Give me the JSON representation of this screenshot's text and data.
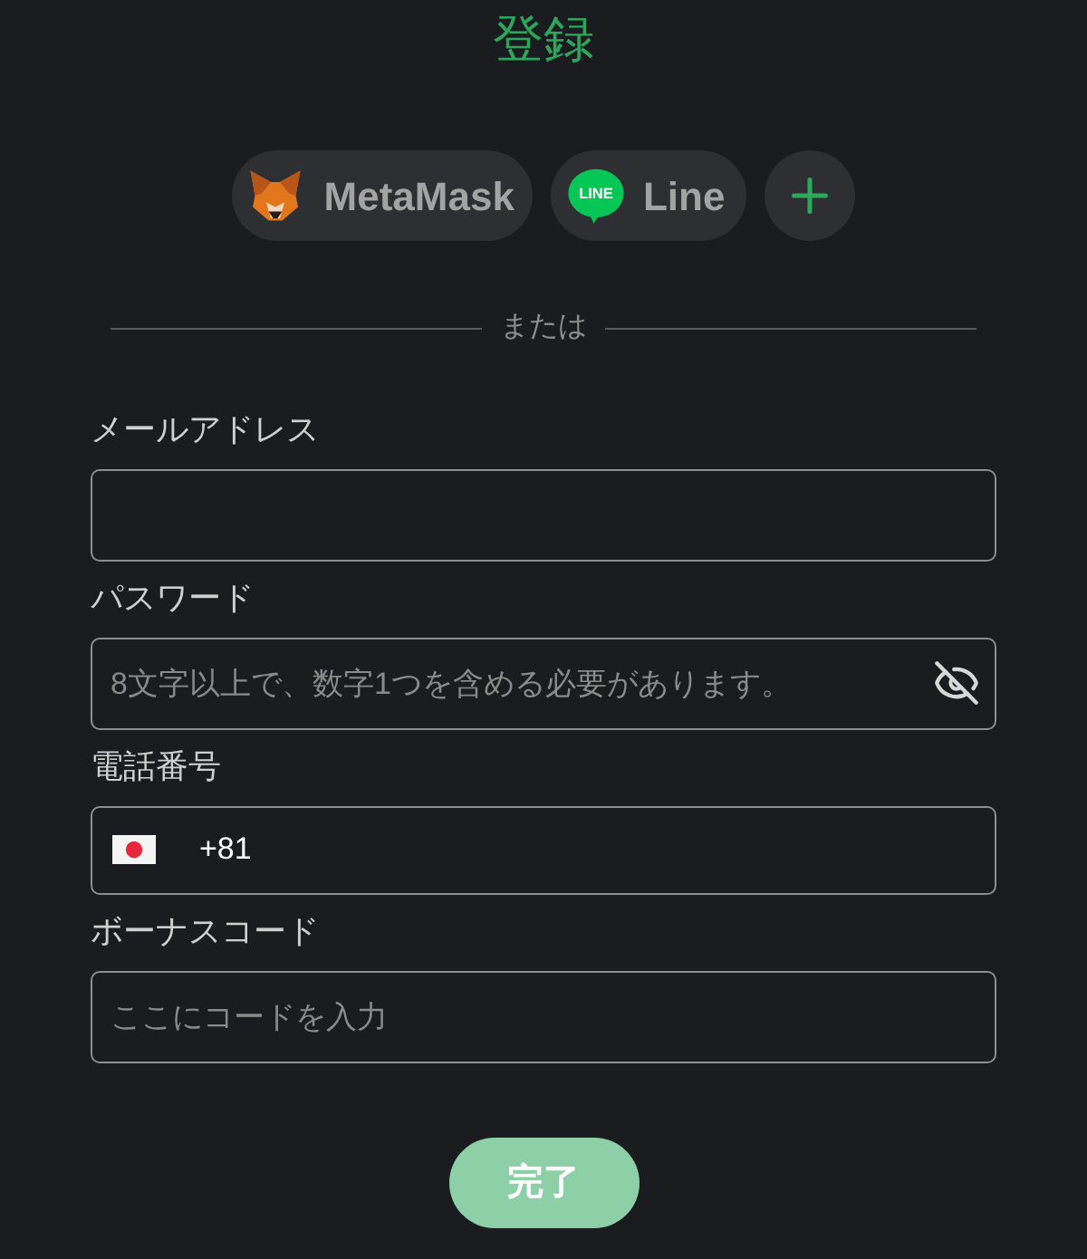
{
  "title": "登録",
  "social_buttons": [
    {
      "kind": "wallet",
      "label": "MetaMask"
    },
    {
      "kind": "chat",
      "label": "Line",
      "logo_text": "LINE"
    },
    {
      "kind": "more"
    }
  ],
  "divider": "または",
  "fields": [
    {
      "kind": "text",
      "label": "メールアドレス"
    },
    {
      "kind": "password",
      "label": "パスワード",
      "placeholder": "8文字以上で、数字1つを含める必要があります。",
      "revealed": false
    },
    {
      "kind": "phone",
      "label": "電話番号",
      "country_code": "+81"
    },
    {
      "kind": "text",
      "label": "ボーナスコード",
      "placeholder": "ここにコードを入力"
    }
  ],
  "submit": {
    "label": "完了",
    "disabled": true
  }
}
